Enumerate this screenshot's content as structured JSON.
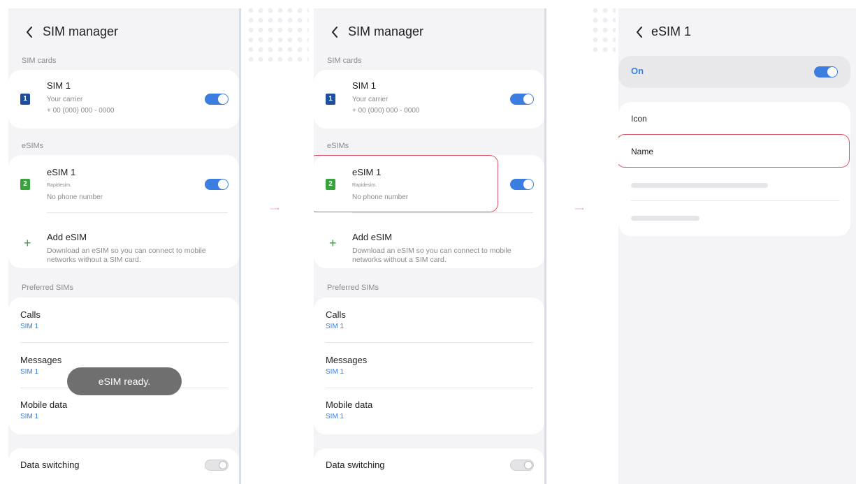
{
  "panels": [
    {
      "title": "SIM manager",
      "sections": {
        "sim_cards": "SIM cards",
        "esims": "eSIMs",
        "preferred": "Preferred SIMs"
      },
      "sim1": {
        "badge": "1",
        "name": "SIM 1",
        "carrier": "Your carrier",
        "number": "+ 00 (000) 000 - 0000",
        "toggle": "on"
      },
      "esim1": {
        "badge": "2",
        "name": "eSIM 1",
        "provider": "Rapidesim.",
        "number": "No phone number",
        "toggle": "on"
      },
      "add_esim": {
        "title": "Add eSIM",
        "description": "Download an eSIM so you can connect to mobile networks without a SIM card."
      },
      "preferred": [
        {
          "label": "Calls",
          "value": "SIM 1"
        },
        {
          "label": "Messages",
          "value": "SIM 1"
        },
        {
          "label": "Mobile data",
          "value": "SIM 1"
        }
      ],
      "data_switching": {
        "label": "Data switching",
        "toggle": "off"
      },
      "toast": "eSIM ready."
    },
    {
      "title": "SIM manager",
      "sections": {
        "sim_cards": "SIM cards",
        "esims": "eSIMs",
        "preferred": "Preferred SIMs"
      },
      "sim1": {
        "badge": "1",
        "name": "SIM 1",
        "carrier": "Your carrier",
        "number": "+ 00 (000) 000 - 0000",
        "toggle": "on"
      },
      "esim1": {
        "badge": "2",
        "name": "eSIM 1",
        "provider": "Rapidesim.",
        "number": "No phone number",
        "toggle": "on"
      },
      "add_esim": {
        "title": "Add eSIM",
        "description": "Download an eSIM so you can connect to mobile networks without a SIM card."
      },
      "preferred": [
        {
          "label": "Calls",
          "value": "SIM 1"
        },
        {
          "label": "Messages",
          "value": "SIM 1"
        },
        {
          "label": "Mobile data",
          "value": "SIM 1"
        }
      ],
      "data_switching": {
        "label": "Data switching",
        "toggle": "off"
      }
    },
    {
      "title": "eSIM 1",
      "on_label": "On",
      "on_toggle": "on",
      "settings": [
        "Icon",
        "Name"
      ]
    }
  ],
  "colors": {
    "accent": "#3b7de0",
    "highlight": "#d9566a",
    "sim1_badge": "#1d4f9c",
    "esim_badge": "#3aa23c",
    "arrow": "#e0485a"
  }
}
